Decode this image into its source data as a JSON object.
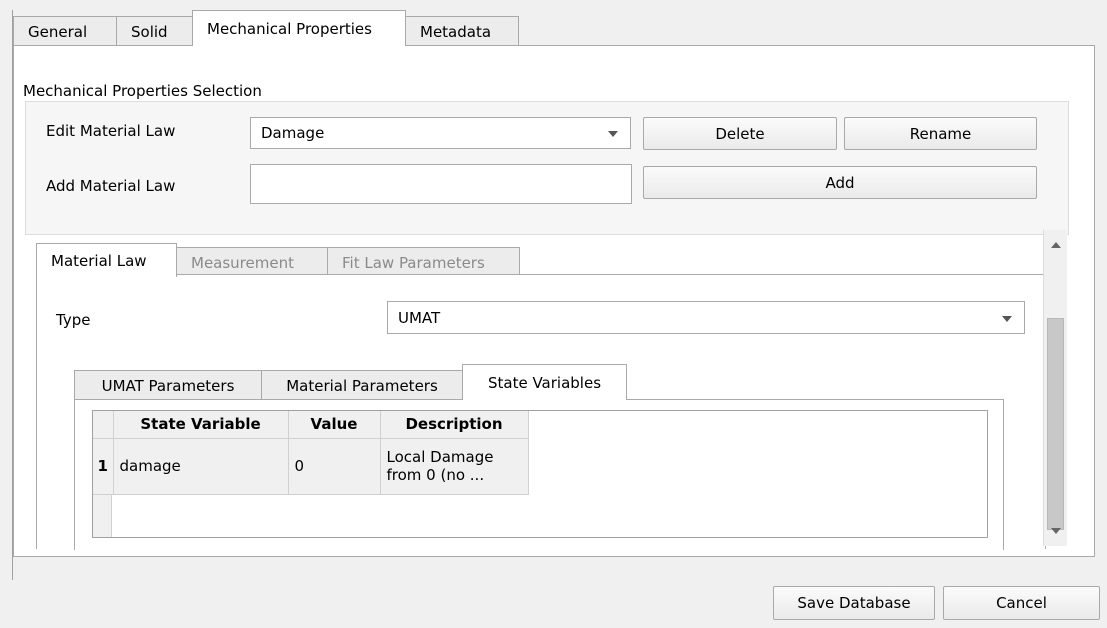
{
  "main_tabs": [
    {
      "label": "General"
    },
    {
      "label": "Solid"
    },
    {
      "label": "Mechanical Properties"
    },
    {
      "label": "Metadata"
    }
  ],
  "section_title": "Mechanical Properties Selection",
  "edit_law": {
    "label": "Edit Material Law",
    "value": "Damage"
  },
  "add_law": {
    "label": "Add Material Law",
    "value": ""
  },
  "buttons": {
    "delete": "Delete",
    "rename": "Rename",
    "add": "Add",
    "save": "Save Database",
    "cancel": "Cancel"
  },
  "law_tabs": [
    {
      "label": "Material Law"
    },
    {
      "label": "Measurement"
    },
    {
      "label": "Fit Law Parameters"
    }
  ],
  "type": {
    "label": "Type",
    "value": "UMAT"
  },
  "sub_tabs": [
    {
      "label": "UMAT Parameters"
    },
    {
      "label": "Material Parameters"
    },
    {
      "label": "State Variables"
    }
  ],
  "table": {
    "headers": [
      "State Variable",
      "Value",
      "Description"
    ],
    "rows": [
      {
        "num": "1",
        "name": "damage",
        "value": "0",
        "desc_line1": "Local Damage",
        "desc_line2": "from 0 (no ..."
      }
    ]
  },
  "icons": {
    "dropdown": "chevron-down-icon",
    "scroll_up": "scroll-up-icon",
    "scroll_down": "scroll-down-icon"
  }
}
